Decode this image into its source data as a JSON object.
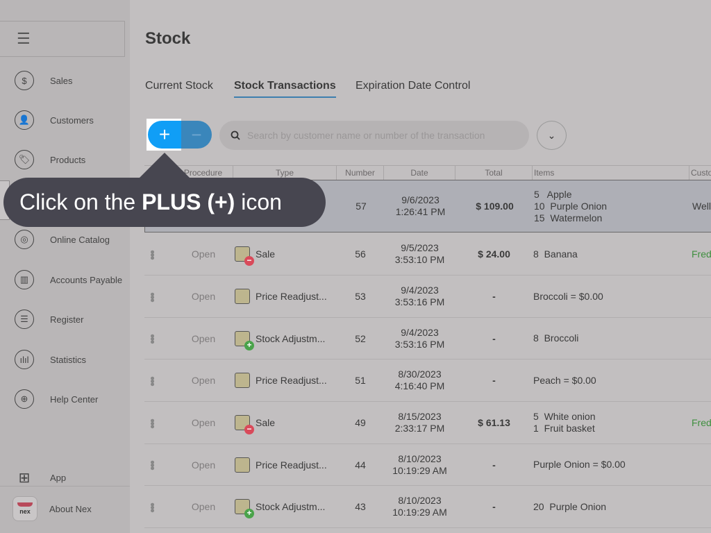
{
  "sidebar": {
    "items": [
      {
        "label": "Sales",
        "icon": "dollar-circle-icon"
      },
      {
        "label": "Customers",
        "icon": "person-icon"
      },
      {
        "label": "Products",
        "icon": "tag-icon"
      },
      {
        "label": "Online Catalog",
        "icon": "globe-icon"
      },
      {
        "label": "Accounts Payable",
        "icon": "invoice-icon"
      },
      {
        "label": "Register",
        "icon": "register-icon"
      },
      {
        "label": "Statistics",
        "icon": "bar-chart-icon"
      },
      {
        "label": "Help Center",
        "icon": "lifebuoy-icon"
      }
    ],
    "app_label": "App",
    "about_label": "About Nex",
    "logo_text": "nex"
  },
  "page": {
    "title": "Stock",
    "tabs": [
      {
        "label": "Current Stock"
      },
      {
        "label": "Stock Transactions",
        "active": true
      },
      {
        "label": "Expiration Date Control"
      }
    ]
  },
  "toolbar": {
    "plus": "+",
    "minus": "−",
    "search_placeholder": "Search by customer name or number of the transaction"
  },
  "table": {
    "headers": [
      "Procedure",
      "Type",
      "Number",
      "Date",
      "Total",
      "Items",
      "Custo"
    ],
    "rows": [
      {
        "procedure": "",
        "type": "",
        "num": "57",
        "date": "9/6/2023",
        "time": "1:26:41 PM",
        "total": "$ 109.00",
        "items": [
          "5   Apple",
          "10  Purple Onion",
          "15  Watermelon"
        ],
        "customer": "Well"
      },
      {
        "procedure": "Open",
        "type": "Sale",
        "badge": "minus",
        "num": "56",
        "date": "9/5/2023",
        "time": "3:53:10 PM",
        "total": "$ 24.00",
        "items": [
          "8  Banana"
        ],
        "customer": "Fred"
      },
      {
        "procedure": "Open",
        "type": "Price Readjust...",
        "badge": "",
        "num": "53",
        "date": "9/4/2023",
        "time": "3:53:16 PM",
        "total": "-",
        "items": [
          "Broccoli = $0.00"
        ],
        "customer": ""
      },
      {
        "procedure": "Open",
        "type": "Stock Adjustm...",
        "badge": "plus",
        "num": "52",
        "date": "9/4/2023",
        "time": "3:53:16 PM",
        "total": "-",
        "items": [
          "8  Broccoli"
        ],
        "customer": ""
      },
      {
        "procedure": "Open",
        "type": "Price Readjust...",
        "badge": "",
        "num": "51",
        "date": "8/30/2023",
        "time": "4:16:40 PM",
        "total": "-",
        "items": [
          "Peach = $0.00"
        ],
        "customer": ""
      },
      {
        "procedure": "Open",
        "type": "Sale",
        "badge": "minus",
        "num": "49",
        "date": "8/15/2023",
        "time": "2:33:17 PM",
        "total": "$ 61.13",
        "items": [
          "5  White onion",
          "1  Fruit basket"
        ],
        "customer": "Fred"
      },
      {
        "procedure": "Open",
        "type": "Price Readjust...",
        "badge": "",
        "num": "44",
        "date": "8/10/2023",
        "time": "10:19:29 AM",
        "total": "-",
        "items": [
          "Purple Onion = $0.00"
        ],
        "customer": ""
      },
      {
        "procedure": "Open",
        "type": "Stock Adjustm...",
        "badge": "plus",
        "num": "43",
        "date": "8/10/2023",
        "time": "10:19:29 AM",
        "total": "-",
        "items": [
          "20  Purple Onion"
        ],
        "customer": ""
      }
    ]
  },
  "tooltip": {
    "prefix": "Click on the ",
    "bold": "PLUS (+)",
    "suffix": " icon"
  },
  "colors": {
    "accent": "#109ef6",
    "tooltip": "#474650",
    "customer_green": "#3f8f3f",
    "badge_minus": "#d94a5a",
    "badge_plus": "#4aa34a"
  }
}
